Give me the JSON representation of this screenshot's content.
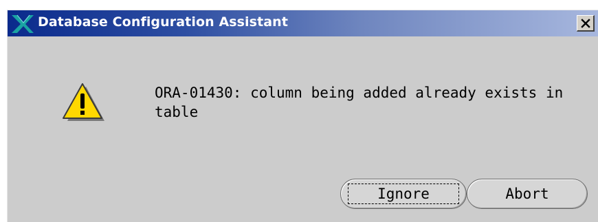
{
  "window": {
    "title": "Database Configuration Assistant",
    "close_label": "✕"
  },
  "message": {
    "text": "ORA-01430: column being added already exists in table",
    "icon": "warning-icon"
  },
  "buttons": {
    "ignore_label": "Ignore",
    "abort_label": "Abort"
  },
  "colors": {
    "title_gradient_start": "#0a2a8c",
    "title_gradient_end": "#a7b7de",
    "dialog_background": "#cccccc",
    "warning_yellow": "#ffd800"
  }
}
